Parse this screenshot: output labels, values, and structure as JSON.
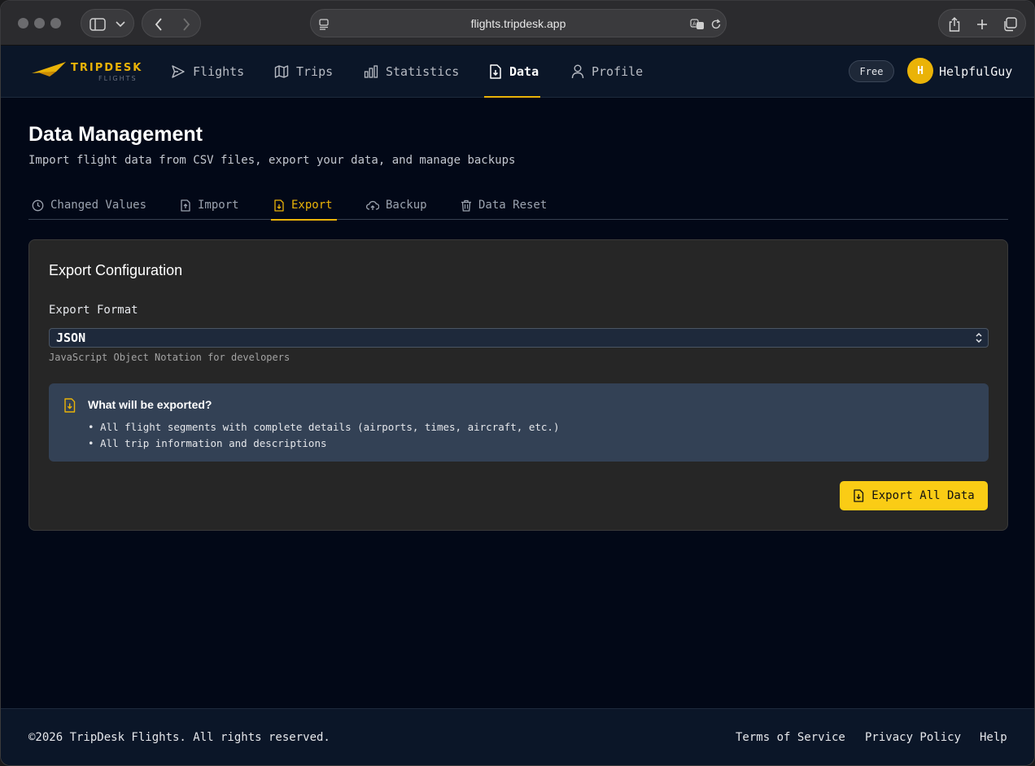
{
  "browser": {
    "url": "flights.tripdesk.app"
  },
  "header": {
    "logo_text": "TRIPDESK",
    "logo_subtext": "FLIGHTS",
    "nav": [
      {
        "label": "Flights",
        "icon": "send-icon"
      },
      {
        "label": "Trips",
        "icon": "map-icon"
      },
      {
        "label": "Statistics",
        "icon": "bar-chart-icon"
      },
      {
        "label": "Data",
        "icon": "file-download-icon",
        "active": true
      },
      {
        "label": "Profile",
        "icon": "user-icon"
      }
    ],
    "plan_badge": "Free",
    "avatar_initial": "H",
    "username": "HelpfulGuy"
  },
  "page": {
    "title": "Data Management",
    "subtitle": "Import flight data from CSV files, export your data, and manage backups",
    "tabs": [
      {
        "label": "Changed Values",
        "icon": "clock-icon"
      },
      {
        "label": "Import",
        "icon": "file-upload-icon"
      },
      {
        "label": "Export",
        "icon": "file-download-icon",
        "active": true
      },
      {
        "label": "Backup",
        "icon": "cloud-upload-icon"
      },
      {
        "label": "Data Reset",
        "icon": "trash-icon"
      }
    ]
  },
  "export": {
    "card_title": "Export Configuration",
    "format_label": "Export Format",
    "format_value": "JSON",
    "format_hint": "JavaScript Object Notation for developers",
    "info_title": "What will be exported?",
    "info_items": [
      "• All flight segments with complete details (airports, times, aircraft, etc.)",
      "• All trip information and descriptions"
    ],
    "button_label": "Export All Data"
  },
  "footer": {
    "copyright": "©2026 TripDesk Flights. All rights reserved.",
    "links": [
      "Terms of Service",
      "Privacy Policy",
      "Help"
    ]
  },
  "colors": {
    "accent": "#eab308",
    "button": "#facc15",
    "background": "#020817",
    "header": "#0b1628",
    "card": "#262626",
    "info_box": "#334155"
  }
}
